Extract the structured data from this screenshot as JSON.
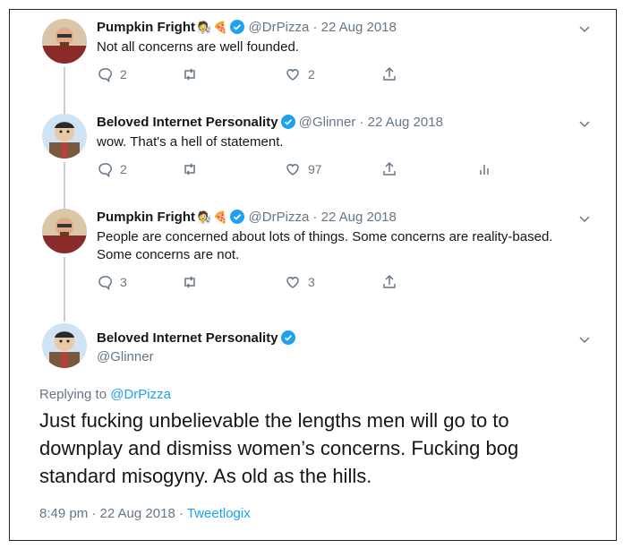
{
  "tweets": [
    {
      "name": "Pumpkin Fright",
      "emojis": [
        "🧑‍🔬",
        "🍕"
      ],
      "handle": "@DrPizza",
      "date": "· 22 Aug 2018",
      "text": "Not all concerns are well founded.",
      "replies": "2",
      "retweets": "",
      "likes": "2"
    },
    {
      "name": "Beloved Internet Personality",
      "emojis": [],
      "handle": "@Glinner",
      "date": "· 22 Aug 2018",
      "text": "wow. That's a hell of statement.",
      "replies": "2",
      "retweets": "",
      "likes": "97"
    },
    {
      "name": "Pumpkin Fright",
      "emojis": [
        "🧑‍🔬",
        "🍕"
      ],
      "handle": "@DrPizza",
      "date": "· 22 Aug 2018",
      "text": "People are concerned about lots of things. Some concerns are reality-based. Some concerns are not.",
      "replies": "3",
      "retweets": "",
      "likes": "3"
    }
  ],
  "focus": {
    "name": "Beloved Internet Personality",
    "handle": "@Glinner",
    "replying_prefix": "Replying to ",
    "replying_to": "@DrPizza",
    "text": "Just fucking unbelievable the lengths men will go to to downplay and dismiss women’s concerns. Fucking bog standard misogyny. As old as the hills.",
    "time_date": "8:49 pm · 22 Aug 2018 · ",
    "source": "Tweetlogix"
  },
  "colors": {
    "accent": "#1da1f2",
    "muted": "#657786",
    "text": "#14171a"
  }
}
